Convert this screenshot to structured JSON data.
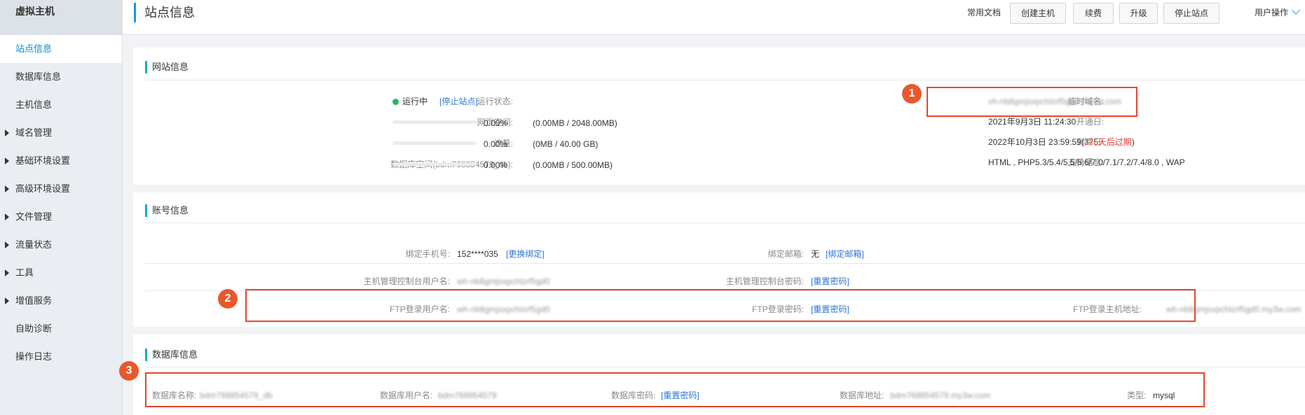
{
  "sidebar": {
    "title": "虚拟主机",
    "items": [
      {
        "label": "站点信息",
        "active": true,
        "expandable": false
      },
      {
        "label": "数据库信息",
        "expandable": false
      },
      {
        "label": "主机信息",
        "expandable": false
      },
      {
        "label": "域名管理",
        "expandable": true
      },
      {
        "label": "基础环境设置",
        "expandable": true
      },
      {
        "label": "高级环境设置",
        "expandable": true
      },
      {
        "label": "文件管理",
        "expandable": true
      },
      {
        "label": "流量状态",
        "expandable": true
      },
      {
        "label": "工具",
        "expandable": true
      },
      {
        "label": "增值服务",
        "expandable": true
      },
      {
        "label": "自助诊断",
        "expandable": false
      },
      {
        "label": "操作日志",
        "expandable": false
      }
    ]
  },
  "header": {
    "title": "站点信息",
    "docs_label": "常用文档",
    "buttons": {
      "create": "创建主机",
      "renew": "续费",
      "upgrade": "升级",
      "stop": "停止站点"
    },
    "user_menu": "用户操作"
  },
  "website": {
    "title": "网站信息",
    "status_label": "运行状态:",
    "status_value": "运行中",
    "stop_link": "[停止站点]",
    "web_space_label": "网页空间:",
    "web_space_percent": "0.00%",
    "web_space_usage": "(0.00MB / 2048.00MB)",
    "web_space_fraction": 0,
    "traffic_label": "流量:",
    "traffic_percent": "0.00%",
    "traffic_usage": "(0MB / 40.00 GB)",
    "traffic_fraction": 0,
    "db_space_label": "数据库空间(bdm768854579_db):",
    "db_space_percent": "0.00%",
    "db_space_usage": "(0.00MB / 500.00MB)",
    "db_space_fraction": 0,
    "temp_domain_label": "临时域名:",
    "temp_domain_value": "vh-nb8gmjsxpchlzrf5gd0.my3w.com",
    "open_date_label": "开通日:",
    "open_date_value": "2021年9月3日 11:24:30",
    "expire_label": "到期日:",
    "expire_value": "2022年10月3日 23:59:59(",
    "expire_warning": "375天后过期",
    "expire_close": ")",
    "languages_label": "支持语言:",
    "languages_value": "HTML , PHP5.3/5.4/5.5/5.6/7.0/7.1/7.2/7.4/8.0 , WAP"
  },
  "account": {
    "title": "账号信息",
    "phone_label": "绑定手机号:",
    "phone_value": "152****035",
    "phone_link": "[更换绑定]",
    "email_label": "绑定邮箱:",
    "email_value": "无",
    "email_link": "[绑定邮箱]",
    "console_user_label": "主机管理控制台用户名:",
    "console_user_value": "wh-nb8gmjsxpchlzrf5gd0",
    "console_pwd_label": "主机管理控制台密码:",
    "console_pwd_link": "[重置密码]",
    "ftp_user_label": "FTP登录用户名:",
    "ftp_user_value": "wh-nb8gmjsxpchlzrf5gd0",
    "ftp_pwd_label": "FTP登录密码:",
    "ftp_pwd_link": "[重置密码]",
    "ftp_host_label": "FTP登录主机地址:",
    "ftp_host_value": "wh-nb8gmjsxpchlzrf5gd0.my3w.com"
  },
  "database": {
    "title": "数据库信息",
    "name_label": "数据库名称:",
    "name_value": "bdm768854579_db",
    "user_label": "数据库用户名:",
    "user_value": "bdm768854579",
    "pwd_label": "数据库密码:",
    "pwd_link": "[重置密码]",
    "addr_label": "数据库地址:",
    "addr_value": "bdm768854579.my3w.com",
    "type_label": "类型:",
    "type_value": "mysql"
  },
  "annotations": [
    "1",
    "2",
    "3"
  ],
  "colors": {
    "accent": "#00a0e9",
    "link": "#2b74d6",
    "annotation": "#e4462c",
    "status_ok": "#2db55d",
    "warning": "#e03c2f"
  }
}
